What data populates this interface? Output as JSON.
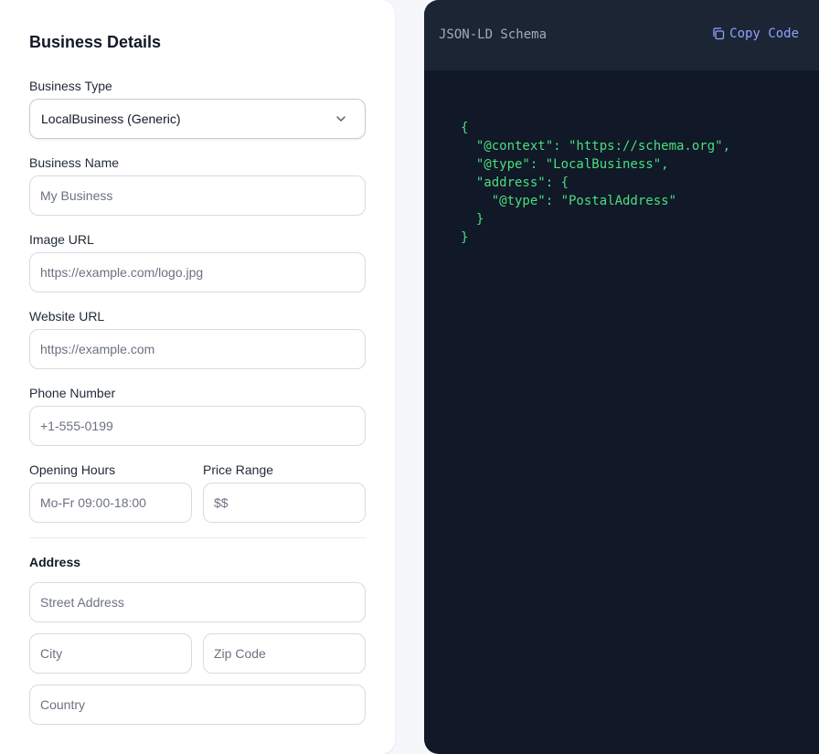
{
  "form": {
    "title": "Business Details",
    "business_type": {
      "label": "Business Type",
      "value": "LocalBusiness (Generic)"
    },
    "business_name": {
      "label": "Business Name",
      "placeholder": "My Business"
    },
    "image_url": {
      "label": "Image URL",
      "placeholder": "https://example.com/logo.jpg"
    },
    "website_url": {
      "label": "Website URL",
      "placeholder": "https://example.com"
    },
    "phone": {
      "label": "Phone Number",
      "placeholder": "+1-555-0199"
    },
    "opening_hours": {
      "label": "Opening Hours",
      "placeholder": "Mo-Fr 09:00-18:00"
    },
    "price_range": {
      "label": "Price Range",
      "placeholder": "$$"
    },
    "address": {
      "label": "Address",
      "street_placeholder": "Street Address",
      "city_placeholder": "City",
      "zip_placeholder": "Zip Code",
      "country_placeholder": "Country"
    }
  },
  "code": {
    "title": "JSON-LD Schema",
    "copy_label": "Copy Code",
    "content": "{\n  \"@context\": \"https://schema.org\",\n  \"@type\": \"LocalBusiness\",\n  \"address\": {\n    \"@type\": \"PostalAddress\"\n  }\n}"
  },
  "colors": {
    "accent": "#8ea2ff",
    "code_text": "#4ade80",
    "code_bg": "#111827",
    "code_header_bg": "#1c2534"
  },
  "icons": {
    "select_caret": "chevron-down-icon",
    "copy": "copy-icon"
  }
}
